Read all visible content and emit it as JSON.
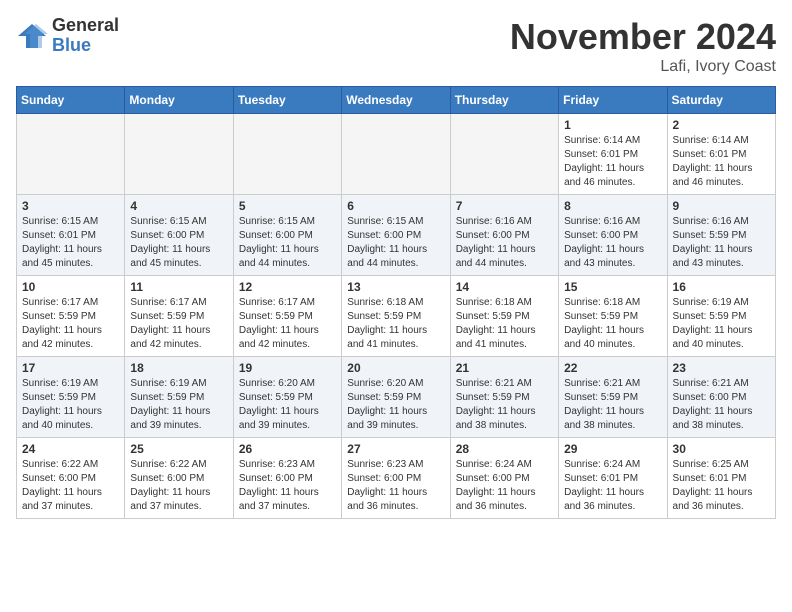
{
  "logo": {
    "general": "General",
    "blue": "Blue"
  },
  "title": {
    "month": "November 2024",
    "location": "Lafi, Ivory Coast"
  },
  "days_of_week": [
    "Sunday",
    "Monday",
    "Tuesday",
    "Wednesday",
    "Thursday",
    "Friday",
    "Saturday"
  ],
  "weeks": [
    [
      {
        "day": "",
        "content": ""
      },
      {
        "day": "",
        "content": ""
      },
      {
        "day": "",
        "content": ""
      },
      {
        "day": "",
        "content": ""
      },
      {
        "day": "",
        "content": ""
      },
      {
        "day": "1",
        "content": "Sunrise: 6:14 AM\nSunset: 6:01 PM\nDaylight: 11 hours and 46 minutes."
      },
      {
        "day": "2",
        "content": "Sunrise: 6:14 AM\nSunset: 6:01 PM\nDaylight: 11 hours and 46 minutes."
      }
    ],
    [
      {
        "day": "3",
        "content": "Sunrise: 6:15 AM\nSunset: 6:01 PM\nDaylight: 11 hours and 45 minutes."
      },
      {
        "day": "4",
        "content": "Sunrise: 6:15 AM\nSunset: 6:00 PM\nDaylight: 11 hours and 45 minutes."
      },
      {
        "day": "5",
        "content": "Sunrise: 6:15 AM\nSunset: 6:00 PM\nDaylight: 11 hours and 44 minutes."
      },
      {
        "day": "6",
        "content": "Sunrise: 6:15 AM\nSunset: 6:00 PM\nDaylight: 11 hours and 44 minutes."
      },
      {
        "day": "7",
        "content": "Sunrise: 6:16 AM\nSunset: 6:00 PM\nDaylight: 11 hours and 44 minutes."
      },
      {
        "day": "8",
        "content": "Sunrise: 6:16 AM\nSunset: 6:00 PM\nDaylight: 11 hours and 43 minutes."
      },
      {
        "day": "9",
        "content": "Sunrise: 6:16 AM\nSunset: 5:59 PM\nDaylight: 11 hours and 43 minutes."
      }
    ],
    [
      {
        "day": "10",
        "content": "Sunrise: 6:17 AM\nSunset: 5:59 PM\nDaylight: 11 hours and 42 minutes."
      },
      {
        "day": "11",
        "content": "Sunrise: 6:17 AM\nSunset: 5:59 PM\nDaylight: 11 hours and 42 minutes."
      },
      {
        "day": "12",
        "content": "Sunrise: 6:17 AM\nSunset: 5:59 PM\nDaylight: 11 hours and 42 minutes."
      },
      {
        "day": "13",
        "content": "Sunrise: 6:18 AM\nSunset: 5:59 PM\nDaylight: 11 hours and 41 minutes."
      },
      {
        "day": "14",
        "content": "Sunrise: 6:18 AM\nSunset: 5:59 PM\nDaylight: 11 hours and 41 minutes."
      },
      {
        "day": "15",
        "content": "Sunrise: 6:18 AM\nSunset: 5:59 PM\nDaylight: 11 hours and 40 minutes."
      },
      {
        "day": "16",
        "content": "Sunrise: 6:19 AM\nSunset: 5:59 PM\nDaylight: 11 hours and 40 minutes."
      }
    ],
    [
      {
        "day": "17",
        "content": "Sunrise: 6:19 AM\nSunset: 5:59 PM\nDaylight: 11 hours and 40 minutes."
      },
      {
        "day": "18",
        "content": "Sunrise: 6:19 AM\nSunset: 5:59 PM\nDaylight: 11 hours and 39 minutes."
      },
      {
        "day": "19",
        "content": "Sunrise: 6:20 AM\nSunset: 5:59 PM\nDaylight: 11 hours and 39 minutes."
      },
      {
        "day": "20",
        "content": "Sunrise: 6:20 AM\nSunset: 5:59 PM\nDaylight: 11 hours and 39 minutes."
      },
      {
        "day": "21",
        "content": "Sunrise: 6:21 AM\nSunset: 5:59 PM\nDaylight: 11 hours and 38 minutes."
      },
      {
        "day": "22",
        "content": "Sunrise: 6:21 AM\nSunset: 5:59 PM\nDaylight: 11 hours and 38 minutes."
      },
      {
        "day": "23",
        "content": "Sunrise: 6:21 AM\nSunset: 6:00 PM\nDaylight: 11 hours and 38 minutes."
      }
    ],
    [
      {
        "day": "24",
        "content": "Sunrise: 6:22 AM\nSunset: 6:00 PM\nDaylight: 11 hours and 37 minutes."
      },
      {
        "day": "25",
        "content": "Sunrise: 6:22 AM\nSunset: 6:00 PM\nDaylight: 11 hours and 37 minutes."
      },
      {
        "day": "26",
        "content": "Sunrise: 6:23 AM\nSunset: 6:00 PM\nDaylight: 11 hours and 37 minutes."
      },
      {
        "day": "27",
        "content": "Sunrise: 6:23 AM\nSunset: 6:00 PM\nDaylight: 11 hours and 36 minutes."
      },
      {
        "day": "28",
        "content": "Sunrise: 6:24 AM\nSunset: 6:00 PM\nDaylight: 11 hours and 36 minutes."
      },
      {
        "day": "29",
        "content": "Sunrise: 6:24 AM\nSunset: 6:01 PM\nDaylight: 11 hours and 36 minutes."
      },
      {
        "day": "30",
        "content": "Sunrise: 6:25 AM\nSunset: 6:01 PM\nDaylight: 11 hours and 36 minutes."
      }
    ]
  ]
}
